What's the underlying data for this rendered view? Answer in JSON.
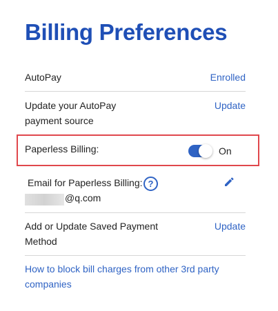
{
  "page": {
    "title": "Billing Preferences"
  },
  "autopay": {
    "label": "AutoPay",
    "value": "Enrolled"
  },
  "autopay_source": {
    "label_line1": "Update your AutoPay",
    "label_line2": "payment source",
    "action": "Update"
  },
  "paperless": {
    "label": "Paperless Billing:",
    "toggle_state": "On",
    "enabled": true
  },
  "paperless_email": {
    "label": "Email for Paperless Billing:",
    "email_visible_part": "@q.com",
    "help_icon": "question-circle-icon",
    "edit_icon": "pencil-icon"
  },
  "saved_payment": {
    "label_line1": "Add or Update Saved Payment",
    "label_line2": "Method",
    "action": "Update"
  },
  "footer_link": {
    "text": "How to block bill charges from other 3rd party companies"
  },
  "colors": {
    "brand_blue": "#1f4fb6",
    "link_blue": "#2f63c4",
    "highlight_red": "#e0474c",
    "divider": "#d6d6d6"
  }
}
